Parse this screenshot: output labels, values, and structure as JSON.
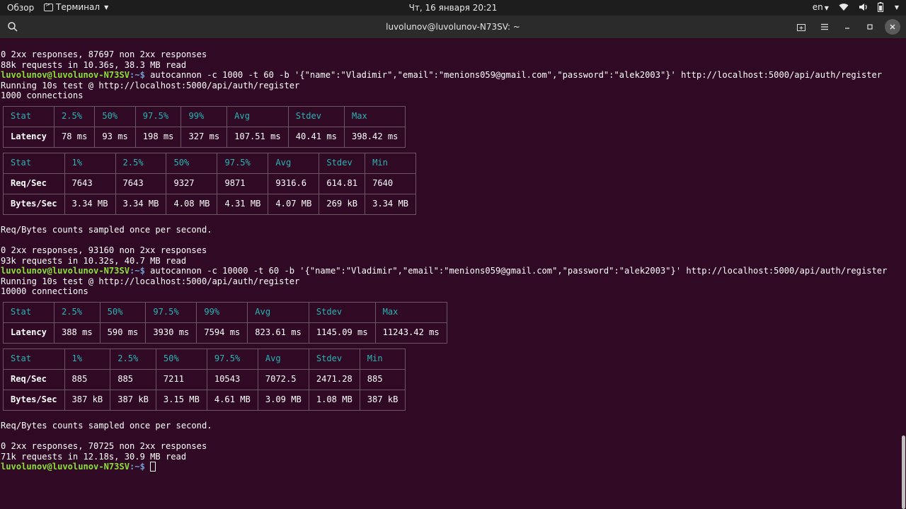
{
  "topbar": {
    "overview": "Обзор",
    "app_name": "Терминал",
    "clock": "Чт, 16 января  20:21",
    "lang": "en"
  },
  "window": {
    "title": "luvolunov@luvolunov-N73SV: ~"
  },
  "prompt": {
    "user": "luvolunov@luvolunov-N73SV",
    "path": ":~$"
  },
  "terminal": {
    "line1": "0 2xx responses, 87697 non 2xx responses",
    "line2": "88k requests in 10.36s, 38.3 MB read",
    "cmd1": " autocannon -c 1000 -t 60 -b '{\"name\":\"Vladimir\",\"email\":\"menions059@gmail.com\",\"password\":\"alek2003\"}' http://localhost:5000/api/auth/register",
    "run1": "Running 10s test @ http://localhost:5000/api/auth/register",
    "conn1": "1000 connections",
    "sampled1": "Req/Bytes counts sampled once per second.",
    "resp1": "0 2xx responses, 93160 non 2xx responses",
    "req1": "93k requests in 10.32s, 40.7 MB read",
    "cmd2": " autocannon -c 10000 -t 60 -b '{\"name\":\"Vladimir\",\"email\":\"menions059@gmail.com\",\"password\":\"alek2003\"}' http://localhost:5000/api/auth/register",
    "run2": "Running 10s test @ http://localhost:5000/api/auth/register",
    "conn2": "10000 connections",
    "sampled2": "Req/Bytes counts sampled once per second.",
    "resp2": "0 2xx responses, 70725 non 2xx responses",
    "req2": "71k requests in 12.18s, 30.9 MB read"
  },
  "tables": {
    "lat1": {
      "header": [
        "Stat",
        "2.5%",
        "50%",
        "97.5%",
        "99%",
        "Avg",
        "Stdev",
        "Max"
      ],
      "rows": [
        [
          "Latency",
          "78 ms",
          "93 ms",
          "198 ms",
          "327 ms",
          "107.51 ms",
          "40.41 ms",
          "398.42 ms"
        ]
      ]
    },
    "req1": {
      "header": [
        "Stat",
        "1%",
        "2.5%",
        "50%",
        "97.5%",
        "Avg",
        "Stdev",
        "Min"
      ],
      "rows": [
        [
          "Req/Sec",
          "7643",
          "7643",
          "9327",
          "9871",
          "9316.6",
          "614.81",
          "7640"
        ],
        [
          "Bytes/Sec",
          "3.34 MB",
          "3.34 MB",
          "4.08 MB",
          "4.31 MB",
          "4.07 MB",
          "269 kB",
          "3.34 MB"
        ]
      ]
    },
    "lat2": {
      "header": [
        "Stat",
        "2.5%",
        "50%",
        "97.5%",
        "99%",
        "Avg",
        "Stdev",
        "Max"
      ],
      "rows": [
        [
          "Latency",
          "388 ms",
          "590 ms",
          "3930 ms",
          "7594 ms",
          "823.61 ms",
          "1145.09 ms",
          "11243.42 ms"
        ]
      ]
    },
    "req2": {
      "header": [
        "Stat",
        "1%",
        "2.5%",
        "50%",
        "97.5%",
        "Avg",
        "Stdev",
        "Min"
      ],
      "rows": [
        [
          "Req/Sec",
          "885",
          "885",
          "7211",
          "10543",
          "7072.5",
          "2471.28",
          "885"
        ],
        [
          "Bytes/Sec",
          "387 kB",
          "387 kB",
          "3.15 MB",
          "4.61 MB",
          "3.09 MB",
          "1.08 MB",
          "387 kB"
        ]
      ]
    }
  },
  "icons": {
    "overview": "activities",
    "app": "terminal-icon",
    "wifi": "wifi-icon",
    "volume": "volume-icon",
    "battery": "battery-icon",
    "search": "search-icon",
    "new_tab": "new-tab-icon",
    "menu": "hamburger-menu-icon",
    "minimize": "minimize-icon",
    "maximize": "maximize-icon",
    "close": "close-icon"
  },
  "colors": {
    "terminal_bg": "#300a24",
    "prompt_user": "#8ae234",
    "prompt_path": "#729fcf",
    "table_header": "#2ab3b3"
  }
}
